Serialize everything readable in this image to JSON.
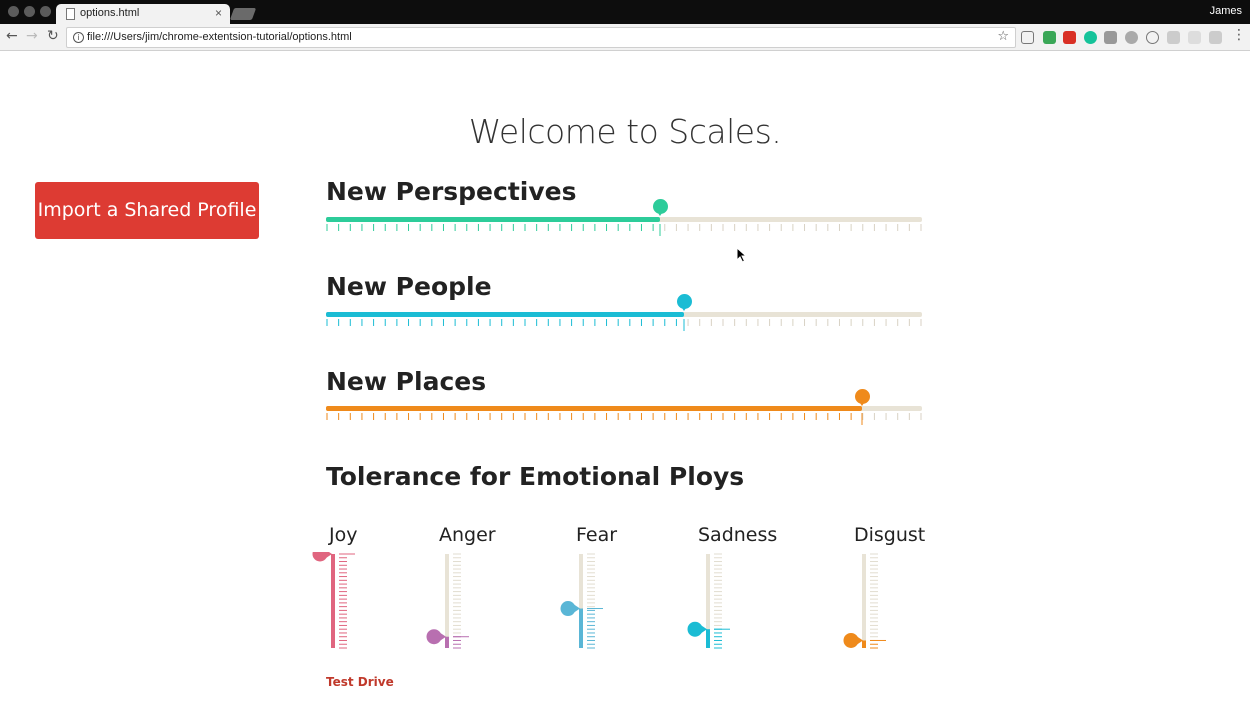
{
  "browser": {
    "tab_title": "options.html",
    "tab_close": "×",
    "profile_name": "James",
    "url": "file:///Users/jim/chrome-extentsion-tutorial/options.html"
  },
  "page": {
    "title": "Welcome to Scales.",
    "import_button": "Import a Shared Profile",
    "test_drive_link": "Test Drive"
  },
  "scales": [
    {
      "label": "New Perspectives",
      "value_percent": 56,
      "color": "#2dcc9a"
    },
    {
      "label": "New People",
      "value_percent": 60,
      "color": "#1bbcd4"
    },
    {
      "label": "New Places",
      "value_percent": 90,
      "color": "#ef8a1b"
    }
  ],
  "emotions": {
    "title": "Tolerance for Emotional Ploys",
    "items": [
      {
        "label": "Joy",
        "value_percent": 100,
        "color": "#e0657f"
      },
      {
        "label": "Anger",
        "value_percent": 12,
        "color": "#b86fb0"
      },
      {
        "label": "Fear",
        "value_percent": 42,
        "color": "#5ab6d6"
      },
      {
        "label": "Sadness",
        "value_percent": 20,
        "color": "#1bbcd4"
      },
      {
        "label": "Disgust",
        "value_percent": 8,
        "color": "#ef8a1b"
      }
    ]
  }
}
